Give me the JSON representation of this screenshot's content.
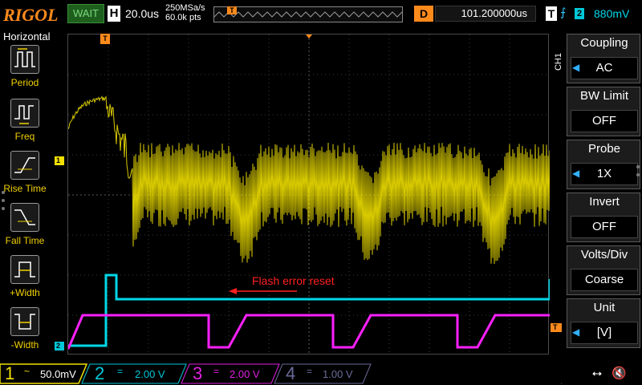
{
  "header": {
    "brand": "RIGOL",
    "run_status": "WAIT",
    "horizontal_label": "H",
    "timebase": "20.0us",
    "sample_rate": "250MSa/s",
    "memory_depth": "60.0k pts",
    "delay_label": "D",
    "delay_value": "101.200000us",
    "trigger_label": "T",
    "trigger_edge": "rising-edge-icon",
    "trigger_source": "2",
    "trigger_level": "880mV",
    "marker_t": "T"
  },
  "left_panel": {
    "title": "Horizontal",
    "items": [
      {
        "label": "Period",
        "icon": "period-icon"
      },
      {
        "label": "Freq",
        "icon": "frequency-icon"
      },
      {
        "label": "Rise Time",
        "icon": "rise-time-icon"
      },
      {
        "label": "Fall Time",
        "icon": "fall-time-icon"
      },
      {
        "label": "+Width",
        "icon": "positive-width-icon"
      },
      {
        "label": "-Width",
        "icon": "negative-width-icon"
      }
    ]
  },
  "screen": {
    "annotation": "Flash error reset",
    "ch1_marker": "1",
    "ch2_marker": "2",
    "trigger_level_marker": "T",
    "trigger_pos_marker": "T",
    "colors": {
      "ch1": "#f0e000",
      "ch2": "#00d8e8",
      "ch3": "#ff20ff",
      "annotation": "#ff2020",
      "trigger": "#ff8a1c"
    }
  },
  "right_panel": {
    "channel_tab": "CH1",
    "menus": [
      {
        "title": "Coupling",
        "value": "AC",
        "arrow": true
      },
      {
        "title": "BW Limit",
        "value": "OFF",
        "arrow": false
      },
      {
        "title": "Probe",
        "value": "1X",
        "arrow": true
      },
      {
        "title": "Invert",
        "value": "OFF",
        "arrow": false
      },
      {
        "title": "Volts/Div",
        "value": "Coarse",
        "arrow": false
      },
      {
        "title": "Unit",
        "value": "[V]",
        "arrow": true
      }
    ]
  },
  "footer": {
    "channels": [
      {
        "number": "1",
        "coupling": "~",
        "scale": "50.0mV",
        "color": "#f0e000"
      },
      {
        "number": "2",
        "coupling": "=",
        "scale": "2.00 V",
        "color": "#00c8d8"
      },
      {
        "number": "3",
        "coupling": "=",
        "scale": "2.00 V",
        "color": "#e020e0"
      },
      {
        "number": "4",
        "coupling": "=",
        "scale": "1.00 V",
        "color": "#6a6a9a"
      }
    ],
    "usb_icon": "usb-icon",
    "sound_icon": "speaker-muted-icon"
  }
}
